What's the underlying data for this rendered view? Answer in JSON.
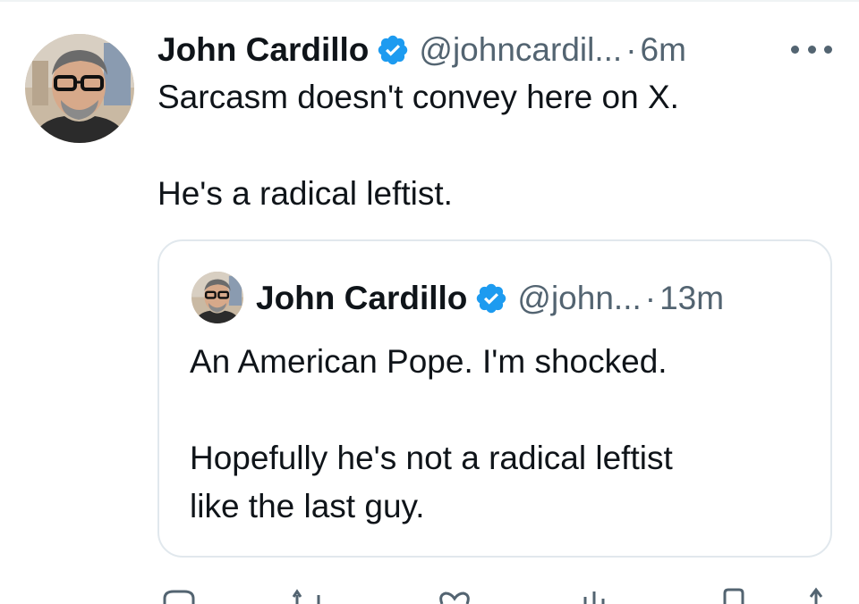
{
  "tweet": {
    "author_name": "John Cardillo",
    "handle": "@johncardil...",
    "separator": "·",
    "time": "6m",
    "text_line1": "Sarcasm doesn't convey here on X.",
    "text_line2": "He's a radical leftist.",
    "more_icon": "more-horizontal-icon",
    "verified_icon": "verified-badge-icon",
    "verified_color": "#1d9bf0"
  },
  "quoted": {
    "author_name": "John Cardillo",
    "handle": "@john...",
    "separator": "·",
    "time": "13m",
    "text_line1": "An American Pope. I'm shocked.",
    "text_line2": "Hopefully he's not a radical leftist",
    "text_line3": "like the last guy."
  },
  "actions": [
    "reply-icon",
    "repost-icon",
    "like-icon",
    "views-icon",
    "bookmark-icon",
    "share-icon"
  ]
}
